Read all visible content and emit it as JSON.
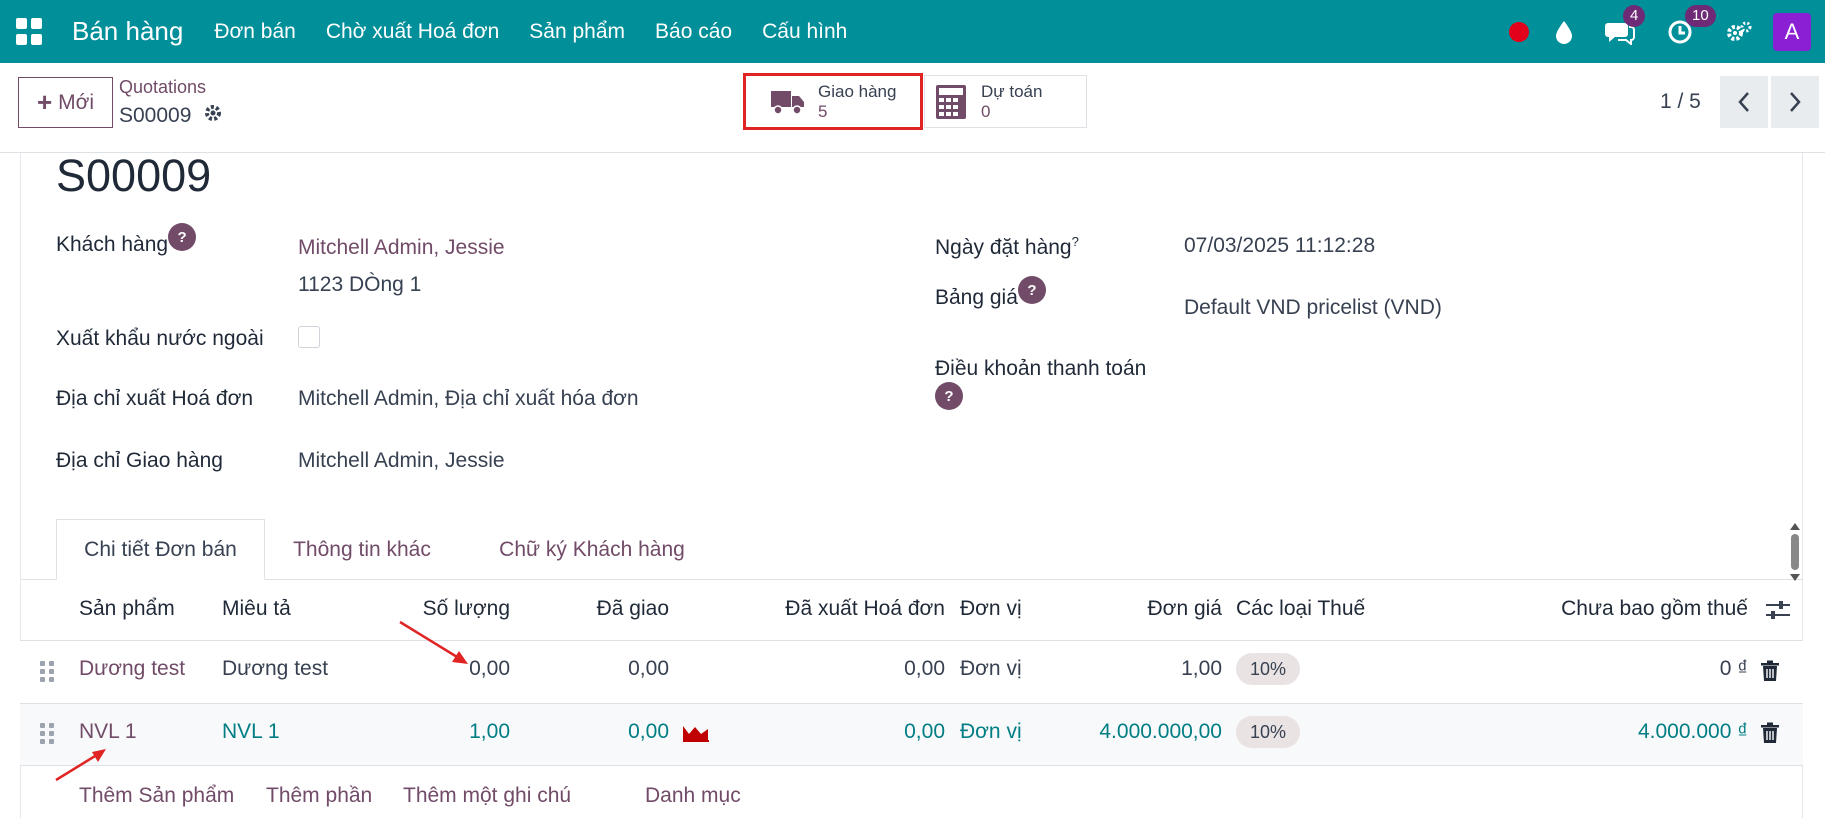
{
  "topbar": {
    "app_title": "Bán hàng",
    "nav": [
      "Đơn bán",
      "Chờ xuất Hoá đơn",
      "Sản phẩm",
      "Báo cáo",
      "Cấu hình"
    ],
    "messages_badge": "4",
    "activities_badge": "10",
    "avatar_letter": "A",
    "color": "#018f9a"
  },
  "control_panel": {
    "new_label": "Mới",
    "breadcrumb_parent": "Quotations",
    "breadcrumb_current": "S00009",
    "smart_buttons": [
      {
        "label": "Giao hàng",
        "value": "5",
        "icon": "truck-icon"
      },
      {
        "label": "Dự toán",
        "value": "0",
        "icon": "calculator-icon"
      }
    ],
    "pager": "1 / 5"
  },
  "form": {
    "title": "S00009",
    "customer_label": "Khách hàng",
    "customer_name": "Mitchell Admin, Jessie",
    "customer_address": "1123 DÒng 1",
    "export_label": "Xuất khẩu nước ngoài",
    "invoice_address_label": "Địa chỉ xuất Hoá đơn",
    "invoice_address": "Mitchell Admin, Địa chỉ xuất hóa đơn",
    "delivery_address_label": "Địa chỉ Giao hàng",
    "delivery_address": "Mitchell Admin, Jessie",
    "order_date_label": "Ngày đặt hàng",
    "order_date_sup": "?",
    "order_date": "07/03/2025 11:12:28",
    "pricelist_label": "Bảng giá",
    "pricelist": "Default VND pricelist (VND)",
    "payment_terms_label": "Điều khoản thanh toán",
    "help_mark": "?"
  },
  "tabs": [
    "Chi tiết Đơn bán",
    "Thông tin khác",
    "Chữ ký Khách hàng"
  ],
  "table": {
    "headers": [
      "Sản phẩm",
      "Miêu tả",
      "Số lượng",
      "Đã giao",
      "Đã xuất Hoá đơn",
      "Đơn vị",
      "Đơn giá",
      "Các loại Thuế",
      "Chưa bao gồm thuế"
    ],
    "rows": [
      {
        "product": "Dương test",
        "description": "Dương test",
        "qty": "0,00",
        "delivered": "0,00",
        "invoiced": "0,00",
        "uom": "Đơn vị",
        "price": "1,00",
        "tax": "10%",
        "subtotal": "0 ₫"
      },
      {
        "product": "NVL 1",
        "description": "NVL 1",
        "qty": "1,00",
        "delivered": "0,00",
        "invoiced": "0,00",
        "uom": "Đơn vị",
        "price": "4.000.000,00",
        "tax": "10%",
        "subtotal": "4.000.000 ₫"
      }
    ],
    "add_links": [
      "Thêm Sản phẩm",
      "Thêm phần",
      "Thêm một ghi chú",
      "Danh mục"
    ]
  },
  "annotation_color": "#e02424"
}
